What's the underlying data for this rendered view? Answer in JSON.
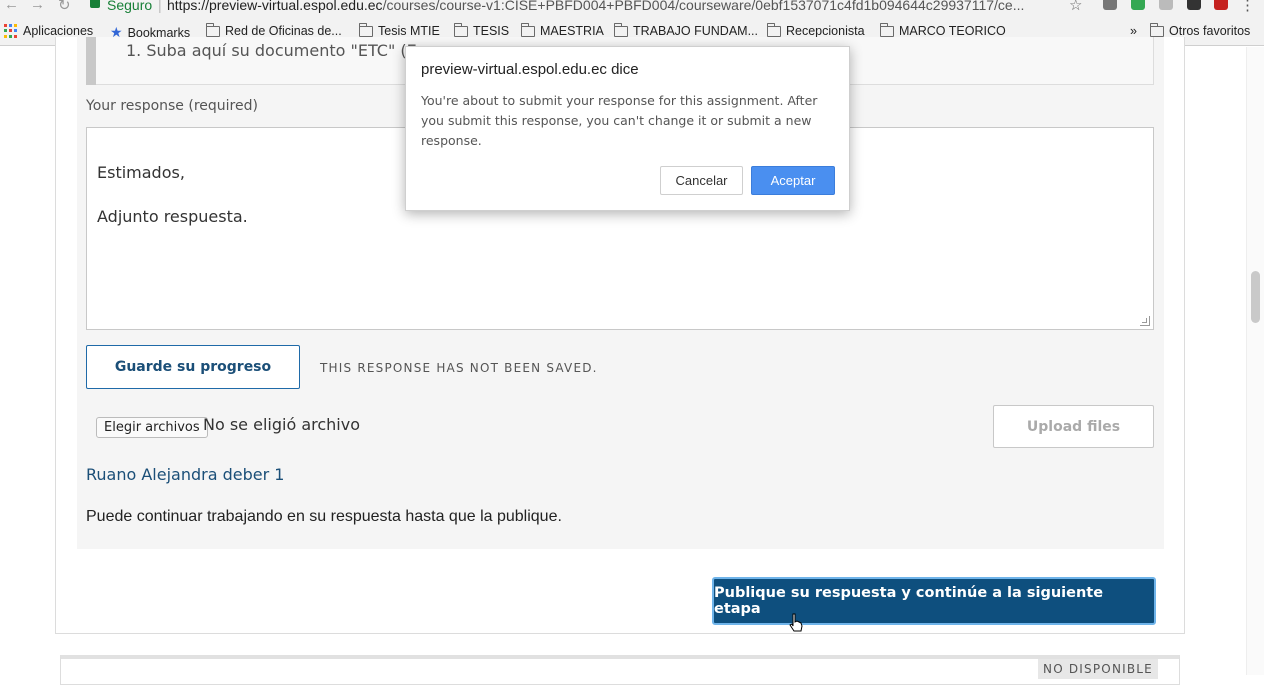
{
  "browser": {
    "secure_label": "Seguro",
    "url_host": "https://preview-virtual.espol.edu.ec",
    "url_path": "/courses/course-v1:CISE+PBFD004+PBFD004/courseware/0ebf1537071c4fd1b094644c29937117/ce...",
    "bookmarks": {
      "apps": "Aplicaciones",
      "bookmarks": "Bookmarks",
      "items": [
        "Red de Oficinas de...",
        "Tesis MTIE",
        "TESIS",
        "MAESTRIA",
        "TRABAJO FUNDAM...",
        "Recepcionista",
        "MARCO TEORICO"
      ],
      "overflow": "»",
      "other": "Otros favoritos"
    }
  },
  "assignment": {
    "prompt_text": "1. Suba aquí su documento \"ETC\" (Exp",
    "response_label": "Your response (required)",
    "response_text": "Estimados,\n\nAdjunto respuesta.",
    "save_button": "Guarde su progreso",
    "save_status": "THIS RESPONSE HAS NOT BEEN SAVED.",
    "choose_files_button": "Elegir archivos",
    "no_file_text": "No se eligió archivo",
    "upload_button": "Upload files",
    "uploaded_file_name": "Ruano Alejandra deber 1",
    "continue_note": "Puede continuar trabajando en su respuesta hasta que la publique.",
    "submit_button": "Publique su respuesta y continúe a la siguiente etapa"
  },
  "next_step": {
    "badge": "NO DISPONIBLE"
  },
  "dialog": {
    "title": "preview-virtual.espol.edu.ec dice",
    "message": "You're about to submit your response for this assignment. After you submit this response, you can't change it or submit a new response.",
    "cancel": "Cancelar",
    "ok": "Aceptar"
  },
  "colors": {
    "primary": "#0e4f7e",
    "dialog_ok": "#4a8ff0",
    "secure": "#188038"
  }
}
